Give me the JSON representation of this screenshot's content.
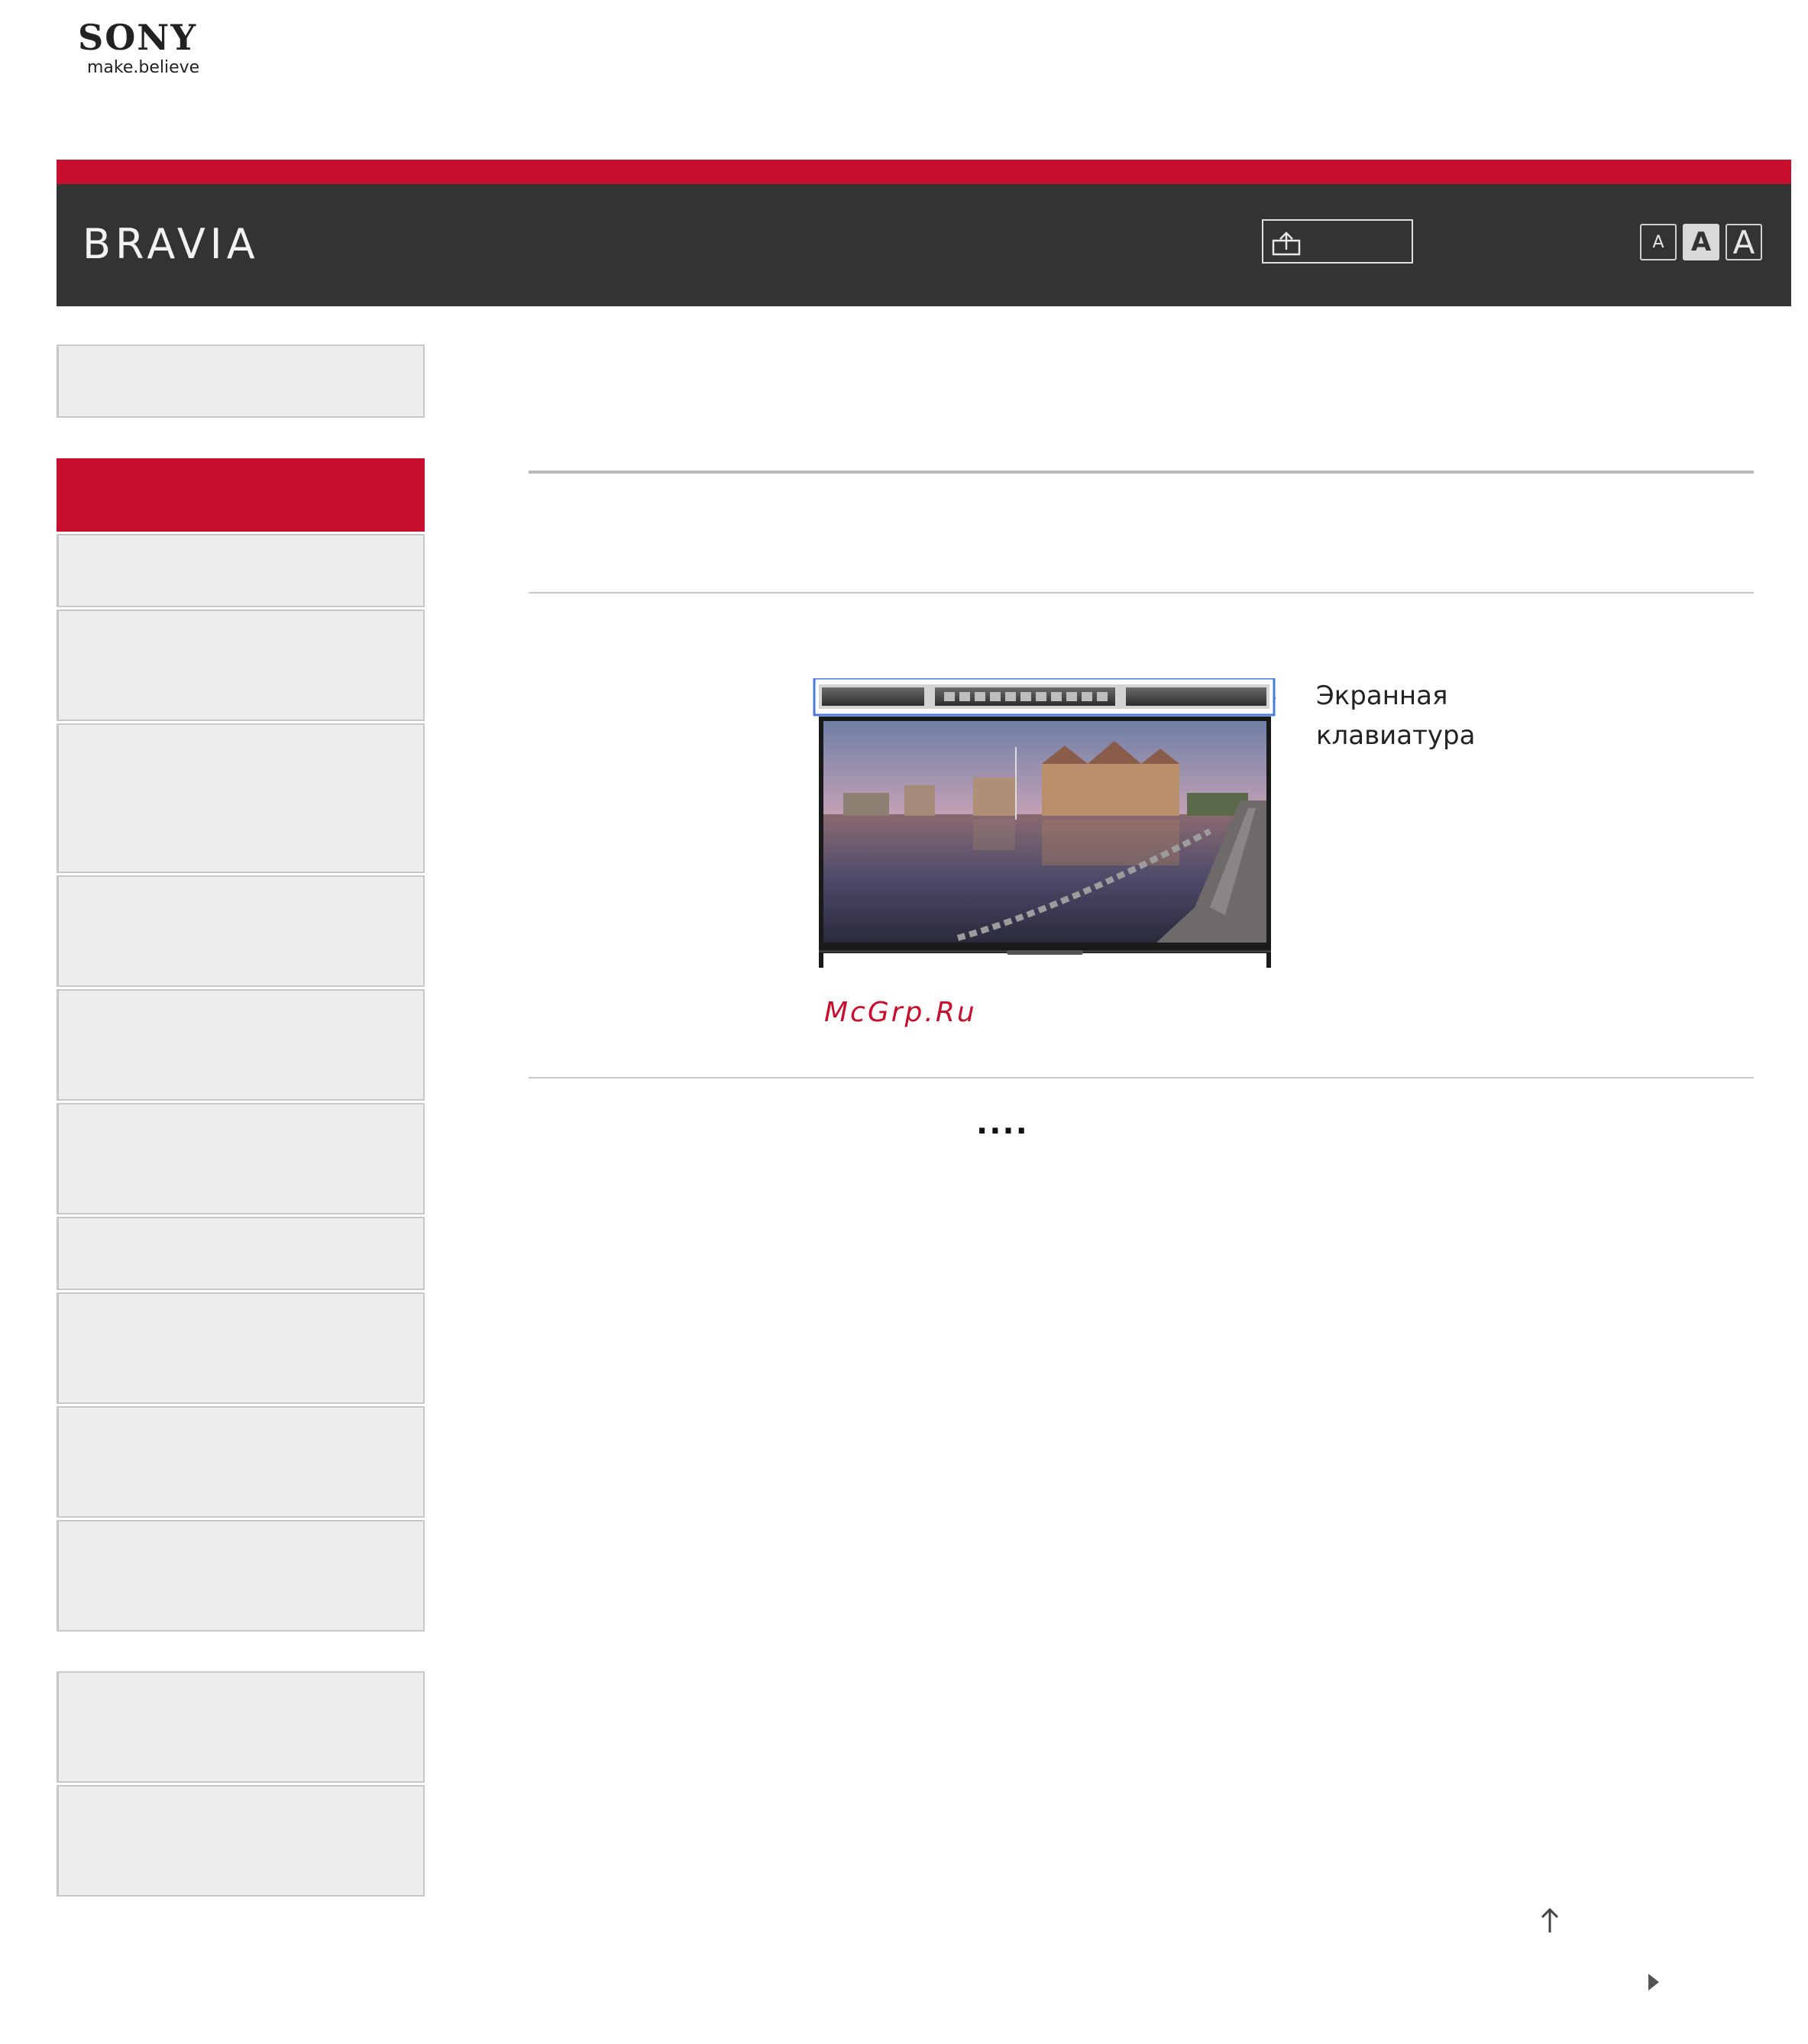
{
  "logo": {
    "brand": "SONY",
    "tagline": "make.believe"
  },
  "header": {
    "title": "BRAVIA",
    "font_size_buttons": [
      "A",
      "A",
      "A"
    ],
    "accent_color": "#c8102e",
    "bar_color": "#333333"
  },
  "figure": {
    "callout_line1": "Экранная",
    "callout_line2": "клавиатура"
  },
  "watermark": "McGrp.Ru",
  "ellipsis": "...."
}
